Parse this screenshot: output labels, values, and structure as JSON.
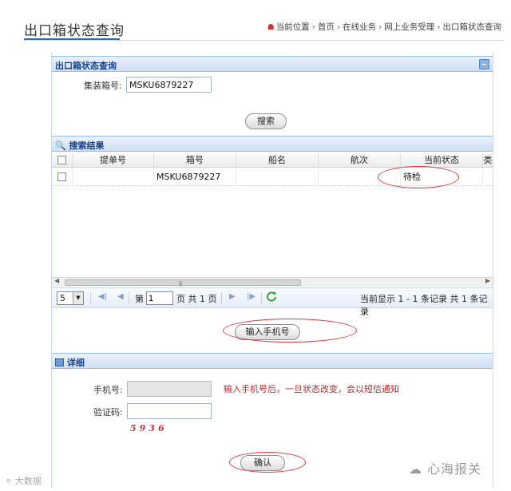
{
  "page_title": "出口箱状态查询",
  "breadcrumb": [
    "当前位置",
    "首页",
    "在线业务",
    "网上业务受理",
    "出口箱状态查询"
  ],
  "query_panel": {
    "title": "出口箱状态查询",
    "container_label": "集装箱号:",
    "container_value": "MSKU6879227",
    "search_button": "搜索"
  },
  "results_panel": {
    "title": "搜索结果",
    "columns": [
      "提单号",
      "箱号",
      "船名",
      "航次",
      "当前状态",
      "类"
    ],
    "rows": [
      {
        "bill": "",
        "container": "MSKU6879227",
        "vessel": "",
        "voyage": "",
        "status": "待检"
      }
    ],
    "pager": {
      "page_size": "5",
      "page_prefix": "第",
      "page_value": "1",
      "page_suffix": "页 共 1 页",
      "summary": "当前显示 1 - 1 条记录 共 1 条记录"
    },
    "phone_button": "输入手机号"
  },
  "detail_panel": {
    "title": "详细",
    "phone_label": "手机号:",
    "phone_value": "",
    "notice": "输入手机号后，一旦状态改变，会以短信通知",
    "captcha_label": "验证码:",
    "captcha_value": "",
    "captcha_code": "5936",
    "confirm_button": "确认"
  },
  "watermarks": {
    "left": "大数据",
    "right": "心海报关"
  },
  "colors": {
    "panel_header": "#15428b",
    "accent": "#2b6fb5",
    "annotation": "#d9383b",
    "notice": "#b02a2a"
  }
}
